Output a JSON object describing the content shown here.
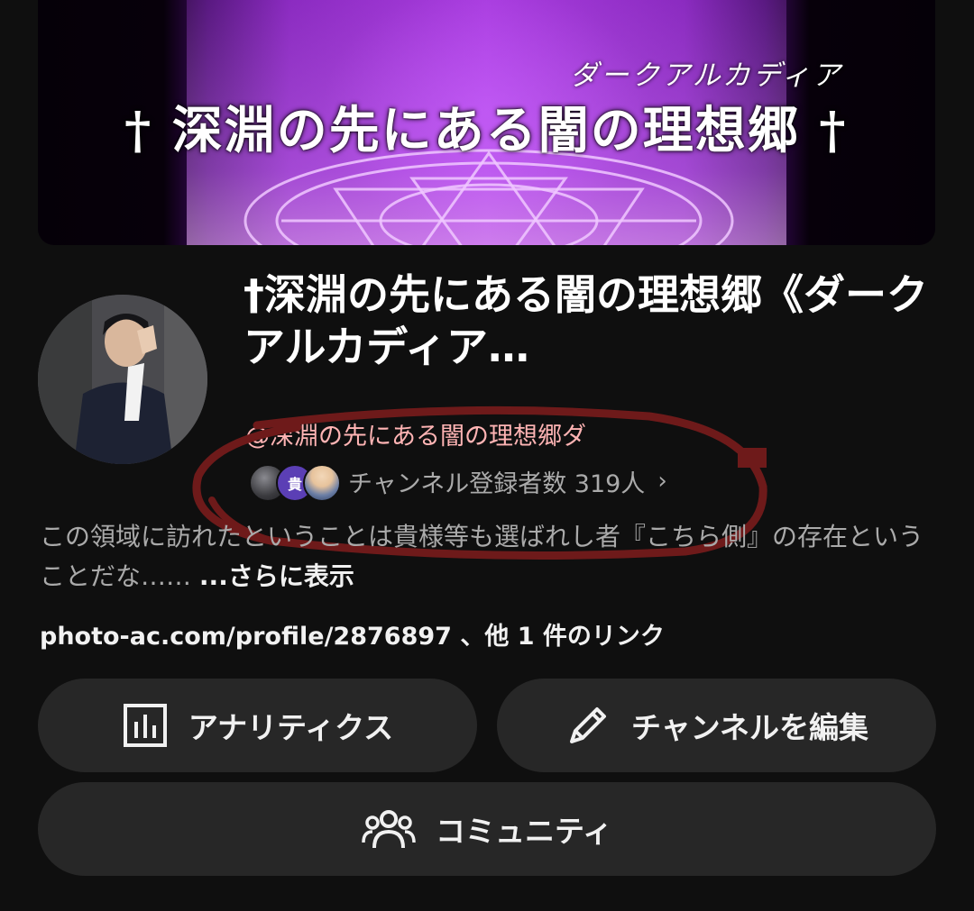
{
  "banner": {
    "kana": "ダークアルカディア",
    "title": "† 深淵の先にある闇の理想郷 †"
  },
  "channel": {
    "name": "†深淵の先にある闇の理想郷《ダークアルカディア…",
    "handle": "@深淵の先にある闇の理想郷ダ",
    "subscriber_badge": "貴",
    "subscribers": "チャンネル登録者数 319人",
    "description": "この領域に訪れたということは貴様等も選ばれし者『こちら側』の存在ということだな……",
    "more_label": "...さらに表示",
    "link": "photo-ac.com/profile/2876897 、他 1 件のリンク"
  },
  "buttons": {
    "analytics": "アナリティクス",
    "edit": "チャンネルを編集",
    "community": "コミュニティ"
  },
  "icons": {
    "analytics": "bar-chart-icon",
    "edit": "pencil-icon",
    "community": "people-icon",
    "chevron": "chevron-right-icon"
  },
  "colors": {
    "background": "#0f0f0f",
    "button": "#272727",
    "handle": "#ffb4b4",
    "secondary_text": "#aaaaaa",
    "annotation": "#6e1a1a"
  }
}
